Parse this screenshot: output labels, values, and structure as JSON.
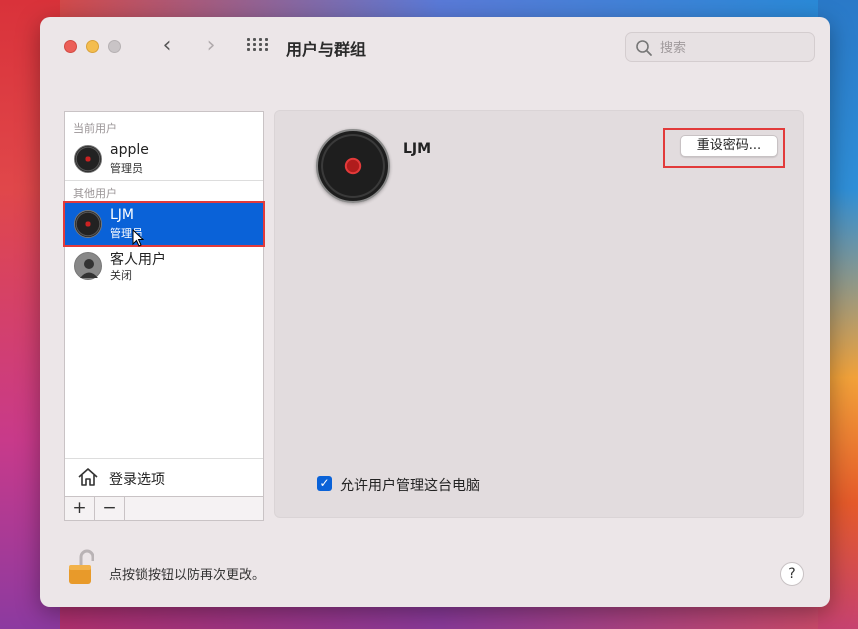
{
  "window": {
    "title": "用户与群组",
    "search": {
      "placeholder": "搜索"
    }
  },
  "sidebar": {
    "current_section": "当前用户",
    "other_section": "其他用户",
    "users": [
      {
        "name": "apple",
        "role": "管理员",
        "avatar": "vinyl-record-avatar",
        "selected": false
      },
      {
        "name": "LJM",
        "role": "管理员",
        "avatar": "vinyl-record-avatar",
        "selected": true
      },
      {
        "name": "客人用户",
        "role": "关闭",
        "avatar": "guest-person-avatar",
        "selected": false
      }
    ],
    "login_options_label": "登录选项",
    "toolbar": {
      "add_label": "+",
      "remove_label": "−"
    }
  },
  "main": {
    "username": "LJM",
    "reset_password_label": "重设密码...",
    "allow_admin": {
      "label": "允许用户管理这台电脑",
      "checked": true
    }
  },
  "footer": {
    "lock_text": "点按锁按钮以防再次更改。",
    "help_label": "?"
  },
  "colors": {
    "selection": "#0a62d8",
    "highlight_border": "#e23b3b",
    "window_bg": "#ece6e8"
  }
}
